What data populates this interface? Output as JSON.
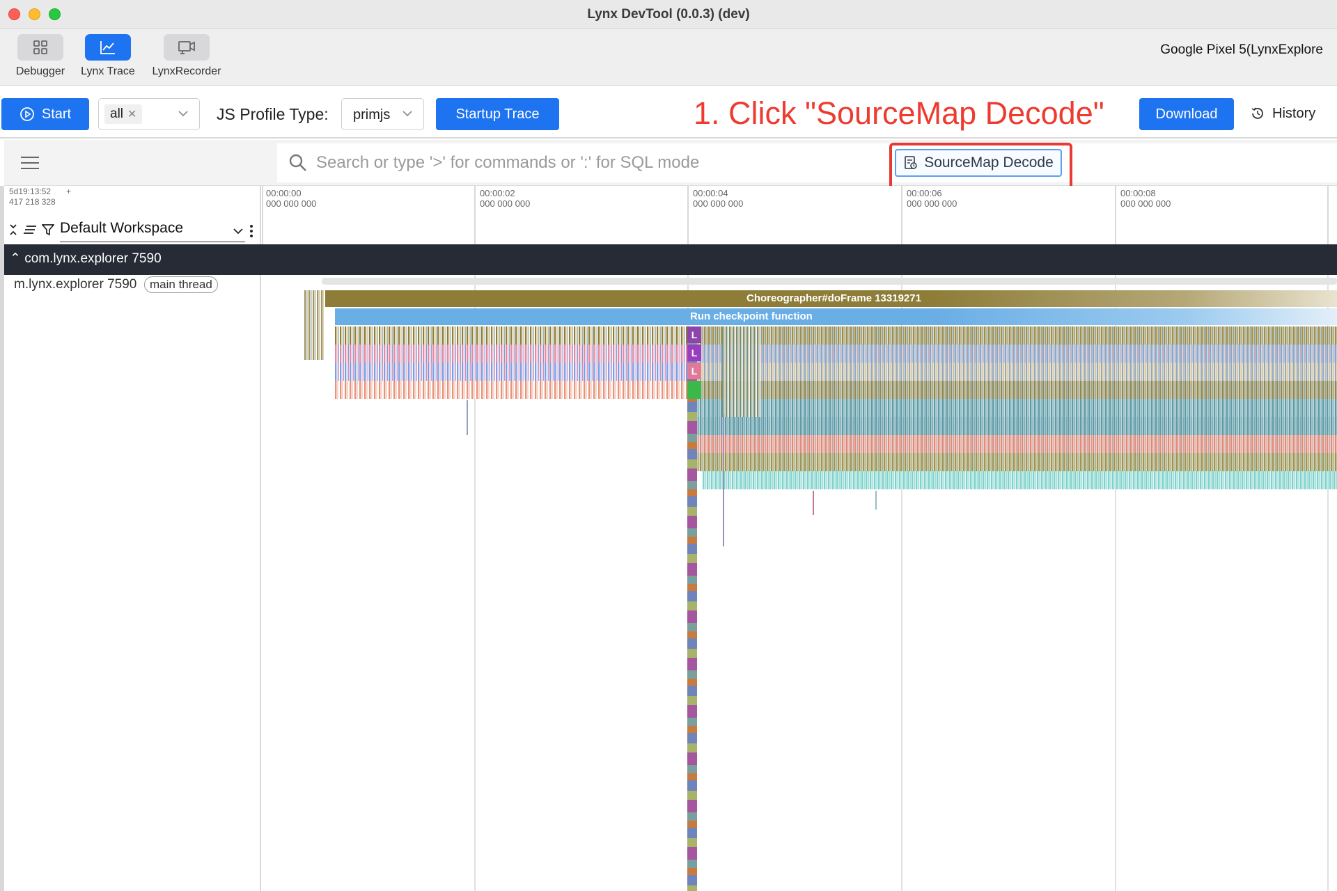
{
  "window": {
    "title": "Lynx DevTool (0.0.3) (dev)"
  },
  "tools": [
    {
      "label": "Debugger",
      "icon": "grid-icon"
    },
    {
      "label": "Lynx Trace",
      "icon": "line-chart-icon"
    },
    {
      "label": "LynxRecorder",
      "icon": "recorder-icon"
    }
  ],
  "device": {
    "name": "Google Pixel 5(LynxExplore"
  },
  "actions": {
    "start_label": "Start",
    "filter_tag": "all",
    "profile_type_label": "JS Profile Type:",
    "profile_type_value": "primjs",
    "startup_trace_label": "Startup Trace",
    "download_label": "Download",
    "history_label": "History"
  },
  "annotation": "1. Click \"SourceMap Decode\"",
  "search": {
    "placeholder": "Search or type '>' for commands or ':' for SQL mode",
    "sourcemap_label": "SourceMap Decode"
  },
  "timeline": {
    "origin_line1": "5d19:13:52",
    "origin_plus": "+",
    "origin_line2": "417 218 328",
    "ticks": [
      {
        "t": "00:00:00",
        "ns": "000 000 000"
      },
      {
        "t": "00:00:02",
        "ns": "000 000 000"
      },
      {
        "t": "00:00:04",
        "ns": "000 000 000"
      },
      {
        "t": "00:00:06",
        "ns": "000 000 000"
      },
      {
        "t": "00:00:08",
        "ns": "000 000 000"
      }
    ]
  },
  "workspace": {
    "name": "Default Workspace"
  },
  "process": {
    "label": "com.lynx.explorer 7590"
  },
  "thread": {
    "label": "m.lynx.explorer 7590",
    "badge": "main thread"
  },
  "slices": {
    "frame": "Choreographer#doFrame 13319271",
    "checkpoint": "Run checkpoint function",
    "marker": "L"
  },
  "colors": {
    "accent": "#1e73f0",
    "annotation": "#ee3b30",
    "process_bar": "#262b36",
    "frame_slice": "#8d7d38",
    "checkpoint_slice": "#6aaee6"
  }
}
